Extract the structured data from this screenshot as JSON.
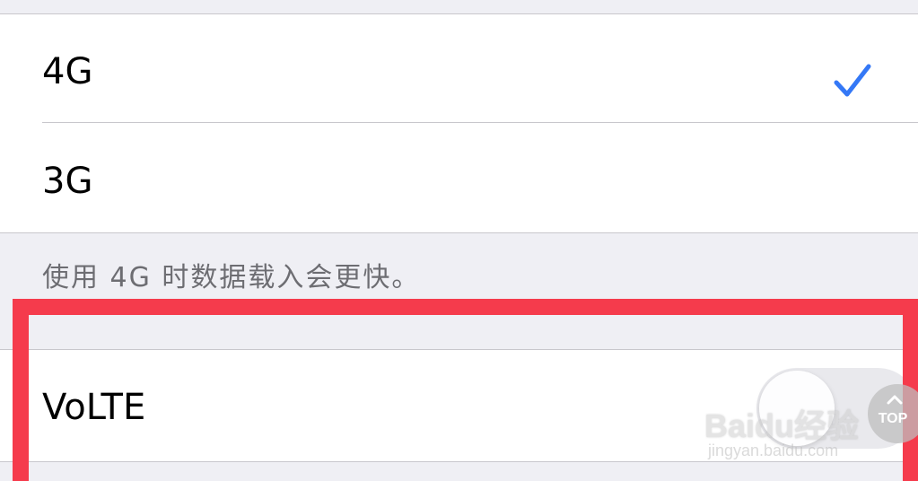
{
  "network_options": {
    "items": [
      {
        "label": "4G",
        "selected": true
      },
      {
        "label": "3G",
        "selected": false
      }
    ],
    "footer": "使用 4G 时数据载入会更快。"
  },
  "volte": {
    "label": "VoLTE",
    "enabled": false
  },
  "overlay": {
    "watermark_logo": "Baidu经验",
    "watermark_url": "jingyan.baidu.com",
    "top_button_label": "TOP"
  },
  "colors": {
    "accent": "#3478f6",
    "highlight": "#f53b4c",
    "background": "#efeff4",
    "separator": "#c8c7cc",
    "footer_text": "#6d6d72"
  },
  "icons": {
    "checkmark": "checkmark-icon",
    "chevron": "chevron-up-icon"
  }
}
